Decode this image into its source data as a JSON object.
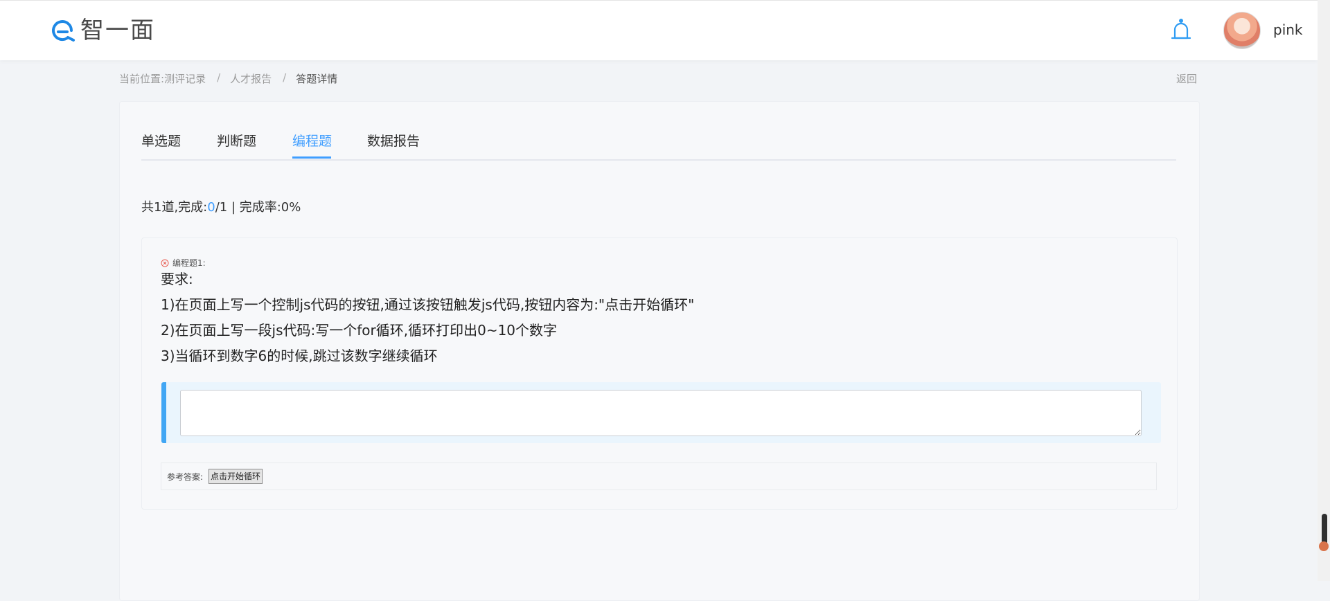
{
  "header": {
    "logo_text": "智一面",
    "notification_icon": "bell-icon",
    "user_name": "pink"
  },
  "breadcrumb": {
    "prefix": "当前位置:",
    "items": [
      "测评记录",
      "人才报告",
      "答题详情"
    ],
    "separator": "/",
    "back": "返回"
  },
  "tabs": [
    {
      "label": "单选题",
      "active": false
    },
    {
      "label": "判断题",
      "active": false
    },
    {
      "label": "编程题",
      "active": true
    },
    {
      "label": "数据报告",
      "active": false
    }
  ],
  "summary": {
    "prefix": "共1道,完成:",
    "completed": "0",
    "total": "/1",
    "rate": " | 完成率:0%"
  },
  "question": {
    "status_icon": "wrong-circle-icon",
    "title": "编程题1:",
    "lines": [
      "要求:",
      "1)在页面上写一个控制js代码的按钮,通过该按钮触发js代码,按钮内容为:\"点击开始循环\"",
      "2)在页面上写一段js代码:写一个for循环,循环打印出0~10个数字",
      "3)当循环到数字6的时候,跳过该数字继续循环"
    ],
    "answer_value": "",
    "reference_label": "参考答案:",
    "reference_button": "点击开始循环"
  },
  "colors": {
    "accent": "#409eff",
    "answer_bar": "#41a6f4",
    "wrong": "#e85a4f"
  }
}
